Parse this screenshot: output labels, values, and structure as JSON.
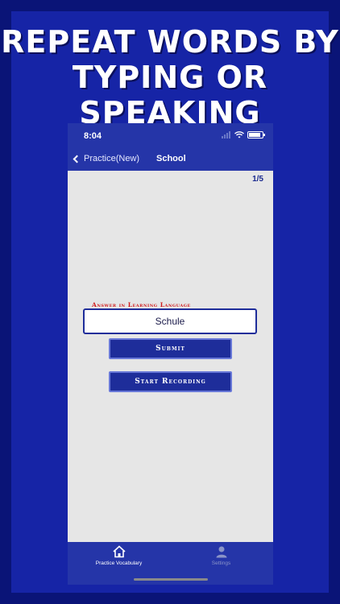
{
  "headline": {
    "line1": "Repeat words by",
    "line2": "typing or",
    "line3": "speaking"
  },
  "status_bar": {
    "time": "8:04"
  },
  "nav": {
    "back_label": "Practice(New)",
    "title": "School"
  },
  "progress": {
    "counter": "1/5"
  },
  "answer": {
    "label": "Answer in Learning Language",
    "value": "Schule"
  },
  "buttons": {
    "submit": "Submit",
    "start_recording": "Start Recording"
  },
  "tabs": [
    {
      "label": "Practice Vocabulary",
      "icon": "home-icon",
      "active": true
    },
    {
      "label": "Settings",
      "icon": "person-icon",
      "active": false
    }
  ],
  "colors": {
    "background": "#1624a6",
    "bar": "#2535a8",
    "button": "#1e2d9a",
    "label_red": "#d11a1a",
    "content_bg": "#e6e6e6"
  }
}
